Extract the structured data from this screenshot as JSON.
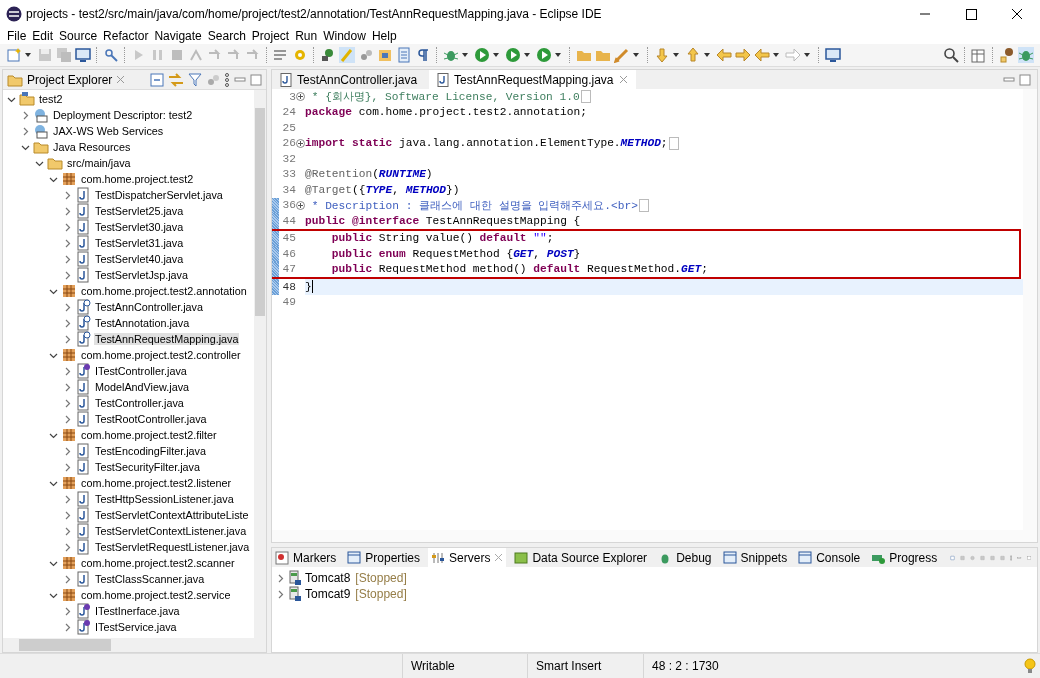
{
  "window": {
    "title": "projects - test2/src/main/java/com/home/project/test2/annotation/TestAnnRequestMapping.java - Eclipse IDE"
  },
  "menu": [
    "File",
    "Edit",
    "Source",
    "Refactor",
    "Navigate",
    "Search",
    "Project",
    "Run",
    "Window",
    "Help"
  ],
  "explorer": {
    "title": "Project Explorer",
    "tree": [
      {
        "label": "test2",
        "kind": "project",
        "expanded": true,
        "selected": false,
        "children": [
          {
            "label": "Deployment Descriptor: test2",
            "kind": "descriptor",
            "expanded": false,
            "selected": false
          },
          {
            "label": "JAX-WS Web Services",
            "kind": "webservices",
            "expanded": false,
            "selected": false
          },
          {
            "label": "Java Resources",
            "kind": "resources",
            "expanded": true,
            "selected": false,
            "children": [
              {
                "label": "src/main/java",
                "kind": "srcfolder",
                "expanded": true,
                "selected": false,
                "children": [
                  {
                    "label": "com.home.project.test2",
                    "kind": "package",
                    "expanded": true,
                    "selected": false,
                    "children": [
                      {
                        "label": "TestDispatcherServlet.java",
                        "kind": "java",
                        "expanded": false,
                        "selected": false
                      },
                      {
                        "label": "TestServlet25.java",
                        "kind": "java",
                        "expanded": false,
                        "selected": false
                      },
                      {
                        "label": "TestServlet30.java",
                        "kind": "java",
                        "expanded": false,
                        "selected": false
                      },
                      {
                        "label": "TestServlet31.java",
                        "kind": "java",
                        "expanded": false,
                        "selected": false
                      },
                      {
                        "label": "TestServlet40.java",
                        "kind": "java",
                        "expanded": false,
                        "selected": false
                      },
                      {
                        "label": "TestServletJsp.java",
                        "kind": "java",
                        "expanded": false,
                        "selected": false
                      }
                    ]
                  },
                  {
                    "label": "com.home.project.test2.annotation",
                    "kind": "package",
                    "expanded": true,
                    "selected": false,
                    "children": [
                      {
                        "label": "TestAnnController.java",
                        "kind": "annotation",
                        "expanded": false,
                        "selected": false
                      },
                      {
                        "label": "TestAnnotation.java",
                        "kind": "annotation",
                        "expanded": false,
                        "selected": false
                      },
                      {
                        "label": "TestAnnRequestMapping.java",
                        "kind": "annotation",
                        "expanded": false,
                        "selected": true
                      }
                    ]
                  },
                  {
                    "label": "com.home.project.test2.controller",
                    "kind": "package",
                    "expanded": true,
                    "selected": false,
                    "children": [
                      {
                        "label": "ITestController.java",
                        "kind": "interface",
                        "expanded": false,
                        "selected": false
                      },
                      {
                        "label": "ModelAndView.java",
                        "kind": "java",
                        "expanded": false,
                        "selected": false
                      },
                      {
                        "label": "TestController.java",
                        "kind": "java",
                        "expanded": false,
                        "selected": false
                      },
                      {
                        "label": "TestRootController.java",
                        "kind": "java",
                        "expanded": false,
                        "selected": false
                      }
                    ]
                  },
                  {
                    "label": "com.home.project.test2.filter",
                    "kind": "package",
                    "expanded": true,
                    "selected": false,
                    "children": [
                      {
                        "label": "TestEncodingFilter.java",
                        "kind": "java",
                        "expanded": false,
                        "selected": false
                      },
                      {
                        "label": "TestSecurityFilter.java",
                        "kind": "java",
                        "expanded": false,
                        "selected": false
                      }
                    ]
                  },
                  {
                    "label": "com.home.project.test2.listener",
                    "kind": "package",
                    "expanded": true,
                    "selected": false,
                    "children": [
                      {
                        "label": "TestHttpSessionListener.java",
                        "kind": "java",
                        "expanded": false,
                        "selected": false
                      },
                      {
                        "label": "TestServletContextAttributeListe",
                        "kind": "java",
                        "expanded": false,
                        "selected": false
                      },
                      {
                        "label": "TestServletContextListener.java",
                        "kind": "java",
                        "expanded": false,
                        "selected": false
                      },
                      {
                        "label": "TestServletRequestListener.java",
                        "kind": "java",
                        "expanded": false,
                        "selected": false
                      }
                    ]
                  },
                  {
                    "label": "com.home.project.test2.scanner",
                    "kind": "package",
                    "expanded": true,
                    "selected": false,
                    "children": [
                      {
                        "label": "TestClassScanner.java",
                        "kind": "java",
                        "expanded": false,
                        "selected": false
                      }
                    ]
                  },
                  {
                    "label": "com.home.project.test2.service",
                    "kind": "package",
                    "expanded": true,
                    "selected": false,
                    "children": [
                      {
                        "label": "ITestInerface.java",
                        "kind": "interface",
                        "expanded": false,
                        "selected": false
                      },
                      {
                        "label": "ITestService.java",
                        "kind": "interface",
                        "expanded": false,
                        "selected": false
                      }
                    ]
                  }
                ]
              }
            ]
          }
        ]
      }
    ]
  },
  "editor": {
    "tabs": [
      {
        "label": "TestAnnController.java",
        "selected": false
      },
      {
        "label": "TestAnnRequestMapping.java",
        "selected": true
      }
    ],
    "lines": [
      {
        "number": "3",
        "folded": true,
        "changed": false,
        "boxed": false,
        "current": false,
        "tokens": [
          {
            "kind": "comment",
            "text": " * {회사명}, Software License, Version 1.0"
          }
        ]
      },
      {
        "number": "24",
        "folded": false,
        "changed": false,
        "boxed": false,
        "current": false,
        "tokens": [
          {
            "kind": "keyword",
            "text": "package"
          },
          {
            "kind": "plain",
            "text": " com.home.project.test2.annotation;"
          }
        ]
      },
      {
        "number": "25",
        "folded": false,
        "changed": false,
        "current": false
      },
      {
        "number": "26",
        "folded": true,
        "changed": false,
        "boxed": false,
        "current": false,
        "tokens": [
          {
            "kind": "keyword",
            "text": "import"
          },
          {
            "kind": "keyword",
            "text": " static"
          },
          {
            "kind": "plain",
            "text": " java.lang.annotation.ElementType."
          },
          {
            "kind": "constant",
            "text": "METHOD"
          },
          {
            "kind": "plain",
            "text": ";"
          }
        ]
      },
      {
        "number": "32",
        "folded": false,
        "changed": false,
        "current": false
      },
      {
        "number": "33",
        "folded": false,
        "changed": false,
        "boxed": false,
        "current": false,
        "tokens": [
          {
            "kind": "annotation",
            "text": "@Retention"
          },
          {
            "kind": "plain",
            "text": "("
          },
          {
            "kind": "constant",
            "text": "RUNTIME"
          },
          {
            "kind": "plain",
            "text": ")"
          }
        ]
      },
      {
        "number": "34",
        "folded": false,
        "changed": false,
        "boxed": false,
        "current": false,
        "tokens": [
          {
            "kind": "annotation",
            "text": "@Target"
          },
          {
            "kind": "plain",
            "text": "({"
          },
          {
            "kind": "constant",
            "text": "TYPE"
          },
          {
            "kind": "plain",
            "text": ", "
          },
          {
            "kind": "constant",
            "text": "METHOD"
          },
          {
            "kind": "plain",
            "text": "})"
          }
        ]
      },
      {
        "number": "36",
        "folded": true,
        "changed": true,
        "boxed": false,
        "current": false,
        "tokens": [
          {
            "kind": "javadoc",
            "text": " * Description : 클래스에 대한 설명을 입력해주세요.<br>"
          }
        ]
      },
      {
        "number": "44",
        "folded": false,
        "changed": true,
        "boxed": false,
        "current": false,
        "tokens": [
          {
            "kind": "keyword",
            "text": "public"
          },
          {
            "kind": "keyword",
            "text": " @interface"
          },
          {
            "kind": "plain",
            "text": " TestAnnRequestMapping {"
          }
        ]
      },
      {
        "number": "45",
        "folded": false,
        "changed": true,
        "boxed": true,
        "current": false,
        "tokens": [
          {
            "kind": "keyword",
            "text": "    public"
          },
          {
            "kind": "plain",
            "text": " String value() "
          },
          {
            "kind": "keyword",
            "text": "default"
          },
          {
            "kind": "string",
            "text": " \"\""
          },
          {
            "kind": "plain",
            "text": ";"
          }
        ]
      },
      {
        "number": "46",
        "folded": false,
        "changed": true,
        "boxed": true,
        "current": false,
        "tokens": [
          {
            "kind": "keyword",
            "text": "    public"
          },
          {
            "kind": "keyword",
            "text": " enum"
          },
          {
            "kind": "plain",
            "text": " RequestMethod {"
          },
          {
            "kind": "constant",
            "text": "GET"
          },
          {
            "kind": "plain",
            "text": ", "
          },
          {
            "kind": "constant",
            "text": "POST"
          },
          {
            "kind": "plain",
            "text": "}"
          }
        ]
      },
      {
        "number": "47",
        "folded": false,
        "changed": true,
        "boxed": true,
        "current": false,
        "tokens": [
          {
            "kind": "keyword",
            "text": "    public"
          },
          {
            "kind": "plain",
            "text": " RequestMethod method() "
          },
          {
            "kind": "keyword",
            "text": "default"
          },
          {
            "kind": "plain",
            "text": " RequestMethod."
          },
          {
            "kind": "constant",
            "text": "GET"
          },
          {
            "kind": "plain",
            "text": ";"
          }
        ]
      },
      {
        "number": "48",
        "folded": false,
        "changed": true,
        "boxed": false,
        "current": true,
        "tokens": [
          {
            "kind": "plain",
            "text": "}"
          }
        ]
      },
      {
        "number": "49",
        "folded": false,
        "changed": false,
        "current": false
      }
    ]
  },
  "bottom_panel": {
    "tabs": [
      {
        "label": "Markers",
        "selected": false
      },
      {
        "label": "Properties",
        "selected": false
      },
      {
        "label": "Servers",
        "selected": true
      },
      {
        "label": "Data Source Explorer",
        "selected": false
      },
      {
        "label": "Debug",
        "selected": false
      },
      {
        "label": "Snippets",
        "selected": false
      },
      {
        "label": "Console",
        "selected": false
      },
      {
        "label": "Progress",
        "selected": false
      }
    ],
    "servers": [
      {
        "name": "Tomcat8",
        "status": "[Stopped]",
        "expanded": false
      },
      {
        "name": "Tomcat9",
        "status": "[Stopped]",
        "expanded": false
      }
    ]
  },
  "status_bar": {
    "mode": "Writable",
    "insert": "Smart Insert",
    "position": "48 : 2 : 1730"
  }
}
